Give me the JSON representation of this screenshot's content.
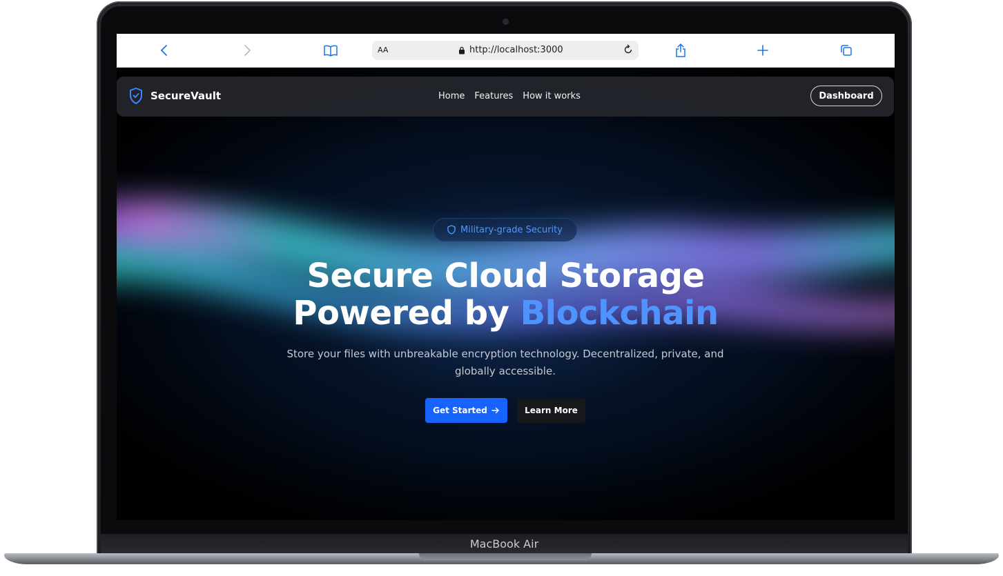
{
  "device": {
    "label": "MacBook Air"
  },
  "browser": {
    "text_size_label": "AA",
    "url": "http://localhost:3000",
    "icons": [
      "back-icon",
      "forward-icon",
      "bookmarks-icon",
      "lock-icon",
      "reload-icon",
      "share-icon",
      "new-tab-icon",
      "tabs-icon"
    ]
  },
  "site": {
    "brand": {
      "name": "SecureVault",
      "icon": "shield-check-icon"
    },
    "nav": {
      "links": [
        "Home",
        "Features",
        "How it works"
      ],
      "dashboard_label": "Dashboard"
    },
    "hero": {
      "badge": "Military-grade Security",
      "badge_icon": "shield-icon",
      "headline_line1": "Secure Cloud Storage",
      "headline_line2_prefix": "Powered by ",
      "headline_line2_accent": "Blockchain",
      "subtext": "Store your files with unbreakable encryption technology. Decentralized, private, and globally accessible.",
      "primary_button": "Get Started",
      "primary_button_icon": "arrow-right-icon",
      "secondary_button": "Learn More"
    },
    "colors": {
      "accent": "#4f93ff",
      "primary_button": "#1663ff",
      "background": "#000000"
    }
  }
}
